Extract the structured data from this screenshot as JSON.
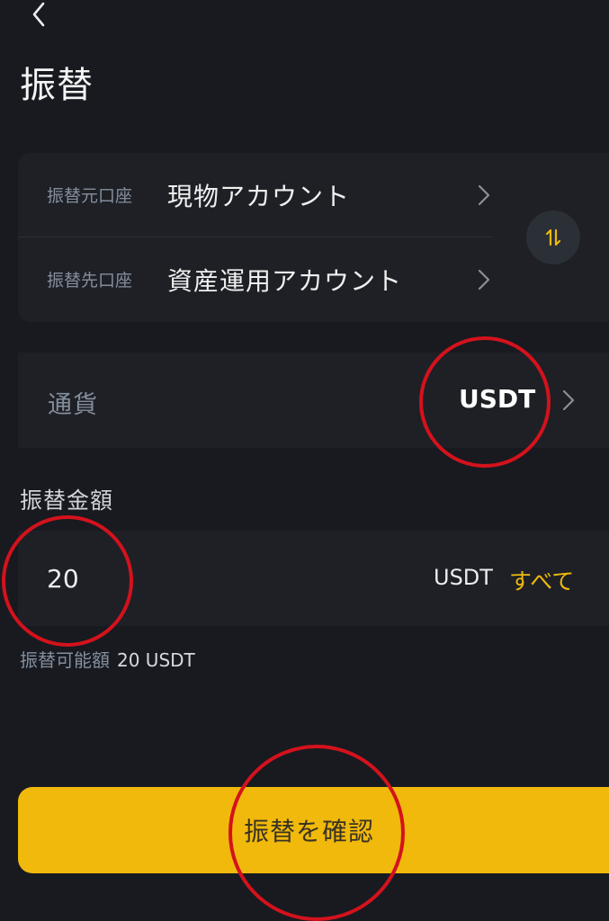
{
  "header": {
    "back_icon": "chevron-left-icon",
    "title": "振替"
  },
  "accounts": {
    "from_label": "振替元口座",
    "from_value": "現物アカウント",
    "to_label": "振替先口座",
    "to_value": "資産運用アカウント",
    "swap_icon": "swap-vertical-icon"
  },
  "currency": {
    "label": "通貨",
    "value": "USDT"
  },
  "amount": {
    "label": "振替金額",
    "value": "20",
    "unit": "USDT",
    "max_label": "すべて"
  },
  "available": {
    "label": "振替可能額",
    "value": "20 USDT"
  },
  "confirm": {
    "label": "振替を確認"
  },
  "colors": {
    "background": "#181a20",
    "card": "#1e2026",
    "accent": "#f0b90b",
    "annotation": "#d4121c"
  }
}
